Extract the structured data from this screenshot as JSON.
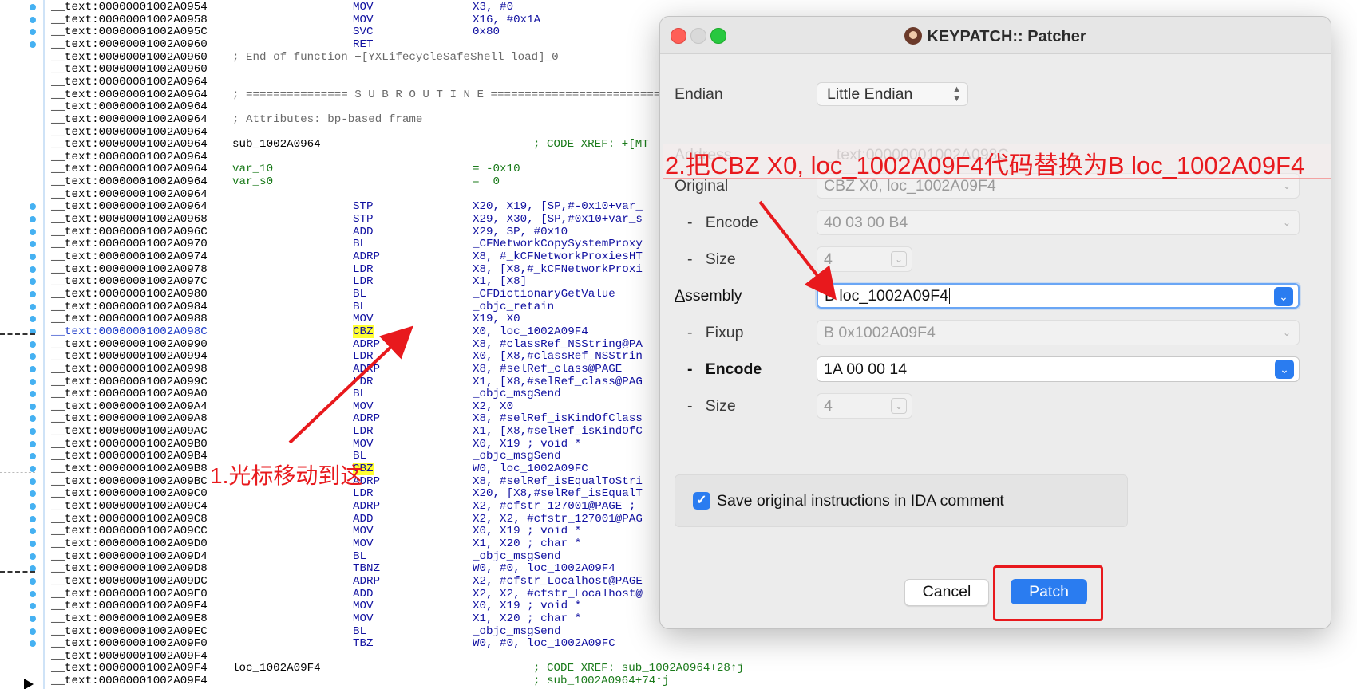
{
  "ida": {
    "lines": [
      {
        "addr": "__text:00000001002A0954",
        "mn": "MOV",
        "op": "X3, #0"
      },
      {
        "addr": "__text:00000001002A0958",
        "mn": "MOV",
        "op": "X16, #0x1A"
      },
      {
        "addr": "__text:00000001002A095C",
        "mn": "SVC",
        "op": "0x80"
      },
      {
        "addr": "__text:00000001002A0960",
        "mn": "RET"
      },
      {
        "addr": "__text:00000001002A0960",
        "comment": "; End of function +[YXLifecycleSafeShell load]_0"
      },
      {
        "addr": "__text:00000001002A0960"
      },
      {
        "addr": "__text:00000001002A0964"
      },
      {
        "addr": "__text:00000001002A0964",
        "comment": "; =============== S U B R O U T I N E ======================================="
      },
      {
        "addr": "__text:00000001002A0964"
      },
      {
        "addr": "__text:00000001002A0964",
        "comment": "; Attributes: bp-based frame"
      },
      {
        "addr": "__text:00000001002A0964"
      },
      {
        "addr": "__text:00000001002A0964",
        "label": "sub_1002A0964",
        "xref": "; CODE XREF: +[MT"
      },
      {
        "addr": "__text:00000001002A0964"
      },
      {
        "addr": "__text:00000001002A0964",
        "label": "var_10",
        "op": "= -0x10",
        "green": true
      },
      {
        "addr": "__text:00000001002A0964",
        "label": "var_s0",
        "op": "=  0",
        "green": true
      },
      {
        "addr": "__text:00000001002A0964"
      },
      {
        "addr": "__text:00000001002A0964",
        "mn": "STP",
        "op": "X20, X19, [SP,#-0x10+var_"
      },
      {
        "addr": "__text:00000001002A0968",
        "mn": "STP",
        "op": "X29, X30, [SP,#0x10+var_s"
      },
      {
        "addr": "__text:00000001002A096C",
        "mn": "ADD",
        "op": "X29, SP, #0x10"
      },
      {
        "addr": "__text:00000001002A0970",
        "mn": "BL",
        "op": "_CFNetworkCopySystemProxy"
      },
      {
        "addr": "__text:00000001002A0974",
        "mn": "ADRP",
        "op": "X8, #_kCFNetworkProxiesHT"
      },
      {
        "addr": "__text:00000001002A0978",
        "mn": "LDR",
        "op": "X8, [X8,#_kCFNetworkProxi"
      },
      {
        "addr": "__text:00000001002A097C",
        "mn": "LDR",
        "op": "X1, [X8]"
      },
      {
        "addr": "__text:00000001002A0980",
        "mn": "BL",
        "op": "_CFDictionaryGetValue"
      },
      {
        "addr": "__text:00000001002A0984",
        "mn": "BL",
        "op": "_objc_retain"
      },
      {
        "addr": "__text:00000001002A0988",
        "mn": "MOV",
        "op": "X19, X0"
      },
      {
        "addr": "__text:00000001002A098C",
        "mn": "CBZ",
        "op": "X0, loc_1002A09F4",
        "sel": true
      },
      {
        "addr": "__text:00000001002A0990",
        "mn": "ADRP",
        "op": "X8, #classRef_NSString@PA"
      },
      {
        "addr": "__text:00000001002A0994",
        "mn": "LDR",
        "op": "X0, [X8,#classRef_NSStrin"
      },
      {
        "addr": "__text:00000001002A0998",
        "mn": "ADRP",
        "op": "X8, #selRef_class@PAGE"
      },
      {
        "addr": "__text:00000001002A099C",
        "mn": "LDR",
        "op": "X1, [X8,#selRef_class@PAG"
      },
      {
        "addr": "__text:00000001002A09A0",
        "mn": "BL",
        "op": "_objc_msgSend"
      },
      {
        "addr": "__text:00000001002A09A4",
        "mn": "MOV",
        "op": "X2, X0"
      },
      {
        "addr": "__text:00000001002A09A8",
        "mn": "ADRP",
        "op": "X8, #selRef_isKindOfClass"
      },
      {
        "addr": "__text:00000001002A09AC",
        "mn": "LDR",
        "op": "X1, [X8,#selRef_isKindOfC"
      },
      {
        "addr": "__text:00000001002A09B0",
        "mn": "MOV",
        "op": "X0, X19 ; void *"
      },
      {
        "addr": "__text:00000001002A09B4",
        "mn": "BL",
        "op": "_objc_msgSend"
      },
      {
        "addr": "__text:00000001002A09B8",
        "mn": "CBZ",
        "op": "W0, loc_1002A09FC",
        "hl": true
      },
      {
        "addr": "__text:00000001002A09BC",
        "mn": "ADRP",
        "op": "X8, #selRef_isEqualToStri"
      },
      {
        "addr": "__text:00000001002A09C0",
        "mn": "LDR",
        "op": "X20, [X8,#selRef_isEqualT"
      },
      {
        "addr": "__text:00000001002A09C4",
        "mn": "ADRP",
        "op": "X2, #cfstr_127001@PAGE ;"
      },
      {
        "addr": "__text:00000001002A09C8",
        "mn": "ADD",
        "op": "X2, X2, #cfstr_127001@PAG"
      },
      {
        "addr": "__text:00000001002A09CC",
        "mn": "MOV",
        "op": "X0, X19 ; void *"
      },
      {
        "addr": "__text:00000001002A09D0",
        "mn": "MOV",
        "op": "X1, X20 ; char *"
      },
      {
        "addr": "__text:00000001002A09D4",
        "mn": "BL",
        "op": "_objc_msgSend"
      },
      {
        "addr": "__text:00000001002A09D8",
        "mn": "TBNZ",
        "op": "W0, #0, loc_1002A09F4"
      },
      {
        "addr": "__text:00000001002A09DC",
        "mn": "ADRP",
        "op": "X2, #cfstr_Localhost@PAGE"
      },
      {
        "addr": "__text:00000001002A09E0",
        "mn": "ADD",
        "op": "X2, X2, #cfstr_Localhost@"
      },
      {
        "addr": "__text:00000001002A09E4",
        "mn": "MOV",
        "op": "X0, X19 ; void *"
      },
      {
        "addr": "__text:00000001002A09E8",
        "mn": "MOV",
        "op": "X1, X20 ; char *"
      },
      {
        "addr": "__text:00000001002A09EC",
        "mn": "BL",
        "op": "_objc_msgSend"
      },
      {
        "addr": "__text:00000001002A09F0",
        "mn": "TBZ",
        "op": "W0, #0, loc_1002A09FC"
      },
      {
        "addr": "__text:00000001002A09F4"
      },
      {
        "addr": "__text:00000001002A09F4",
        "label": "loc_1002A09F4",
        "xref": "; CODE XREF: sub_1002A0964+28↑j"
      },
      {
        "addr": "__text:00000001002A09F4",
        "xref": "; sub_1002A0964+74↑j"
      }
    ]
  },
  "dialog": {
    "title": "KEYPATCH:: Patcher",
    "endian_label": "Endian",
    "endian_value": "Little Endian",
    "address_label": "Address",
    "address_value": "_text:00000001002A098C",
    "original_label": "Original",
    "original_value": "CBZ X0, loc_1002A09F4",
    "original_encode_label": "Encode",
    "original_encode_value": "40 03 00 B4",
    "original_size_label": "Size",
    "original_size_value": "4",
    "assembly_label_first": "A",
    "assembly_label_rest": "ssembly",
    "assembly_value": "B loc_1002A09F4",
    "fixup_label": "Fixup",
    "fixup_value": "B 0x1002A09F4",
    "encode_label": "Encode",
    "encode_value": "1A 00 00 14",
    "size_label": "Size",
    "size_value": "4",
    "dash": "-",
    "save_label": "Save original instructions in IDA comment",
    "save_checked": true,
    "cancel_label": "Cancel",
    "patch_label": "Patch"
  },
  "annotations": {
    "step1": "1.光标移动到这",
    "step2": "2.把CBZ X0, loc_1002A09F4代码替换为B loc_1002A09F4",
    "color": "#e8191d"
  },
  "colors": {
    "accent": "#2a7cf0",
    "breakpoint": "#45b1f2",
    "highlight": "#ffff33"
  }
}
